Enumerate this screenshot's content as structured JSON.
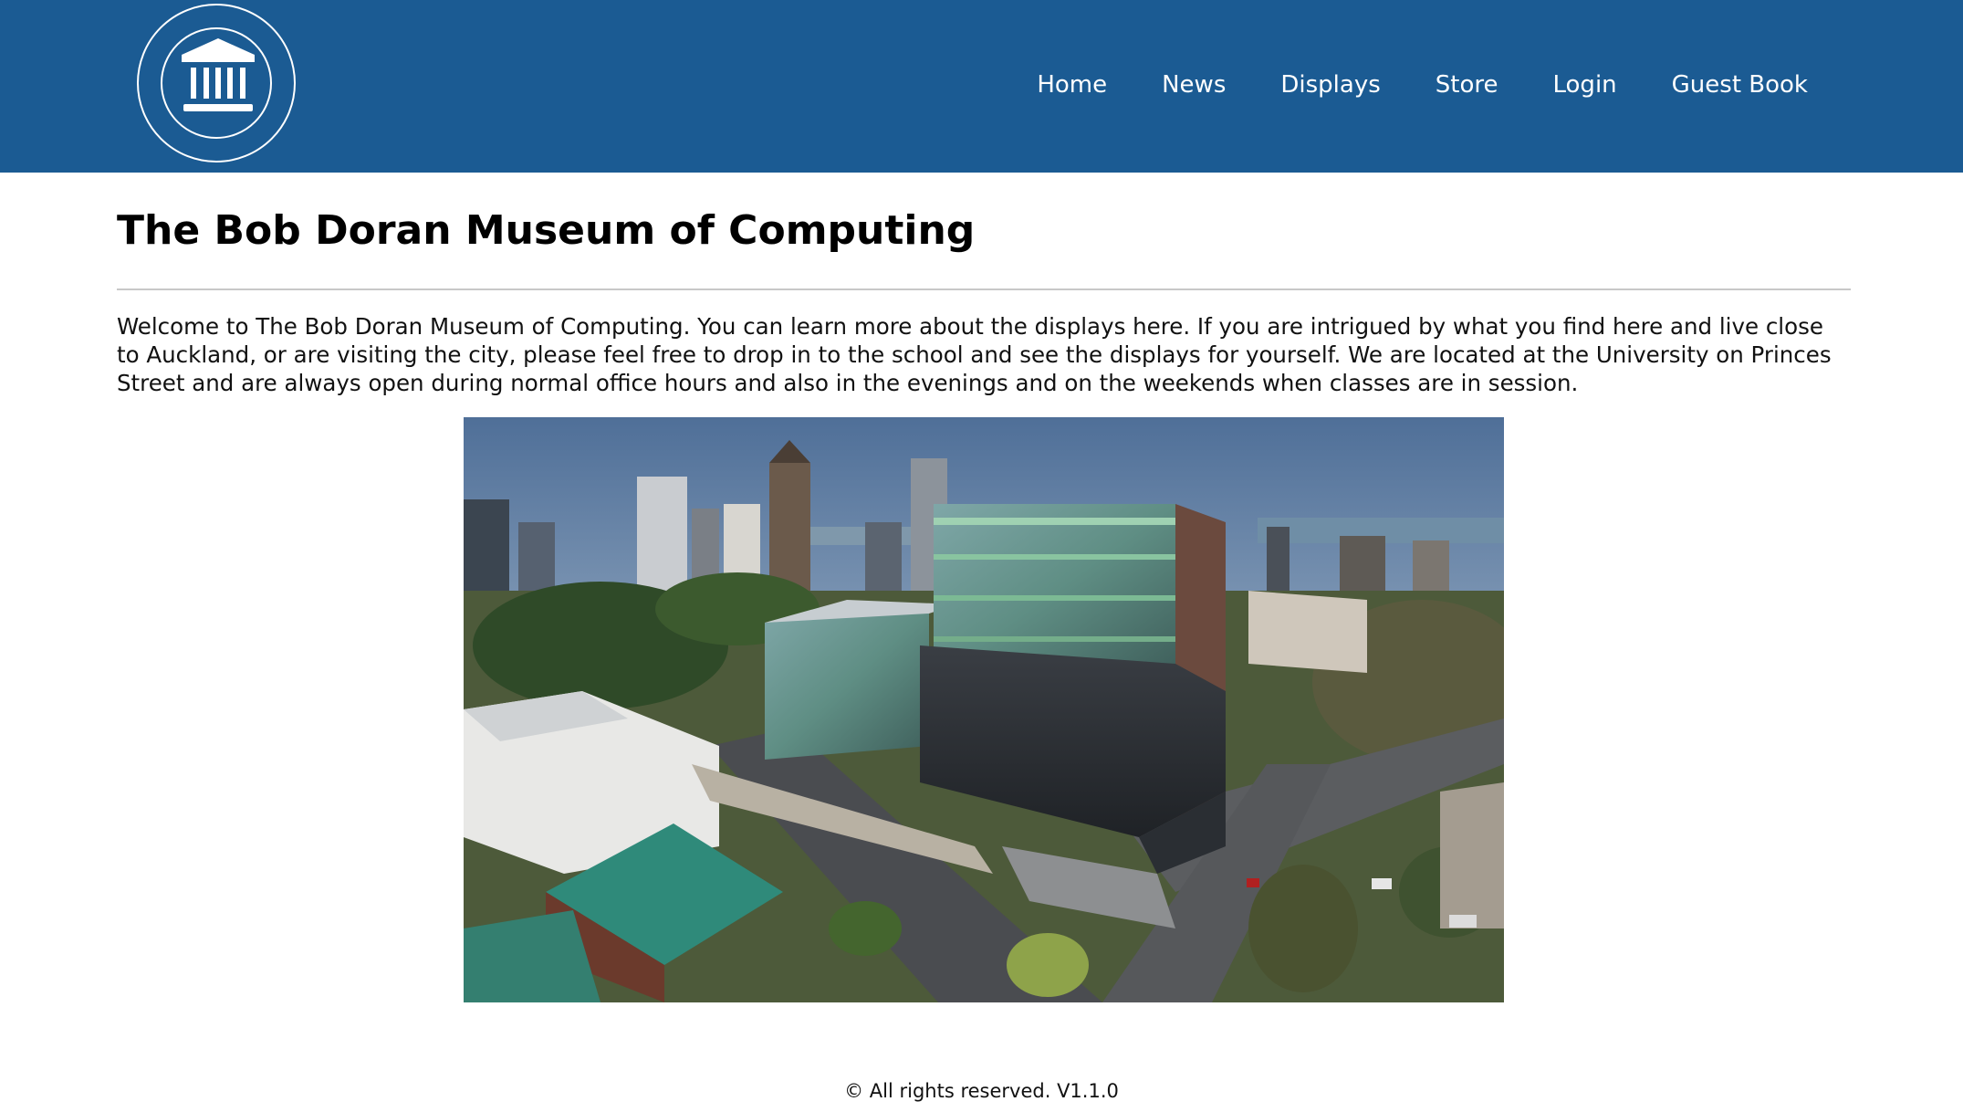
{
  "header": {
    "background": "#1b5b93",
    "logo_icon": "museum-building-icon",
    "nav": [
      {
        "label": "Home"
      },
      {
        "label": "News"
      },
      {
        "label": "Displays"
      },
      {
        "label": "Store"
      },
      {
        "label": "Login"
      },
      {
        "label": "Guest Book"
      }
    ]
  },
  "main": {
    "title": "The Bob Doran Museum of Computing",
    "intro": "Welcome to The Bob Doran Museum of Computing. You can learn more about the displays here. If you are intrigued by what you find here and live close to Auckland, or are visiting the city, please feel free to drop in to the school and see the displays for yourself. We are located at the University on Princes Street and are always open during normal office hours and also in the evenings and on the weekends when classes are in session."
  },
  "footer": {
    "text": "© All rights reserved. V1.1.0"
  }
}
